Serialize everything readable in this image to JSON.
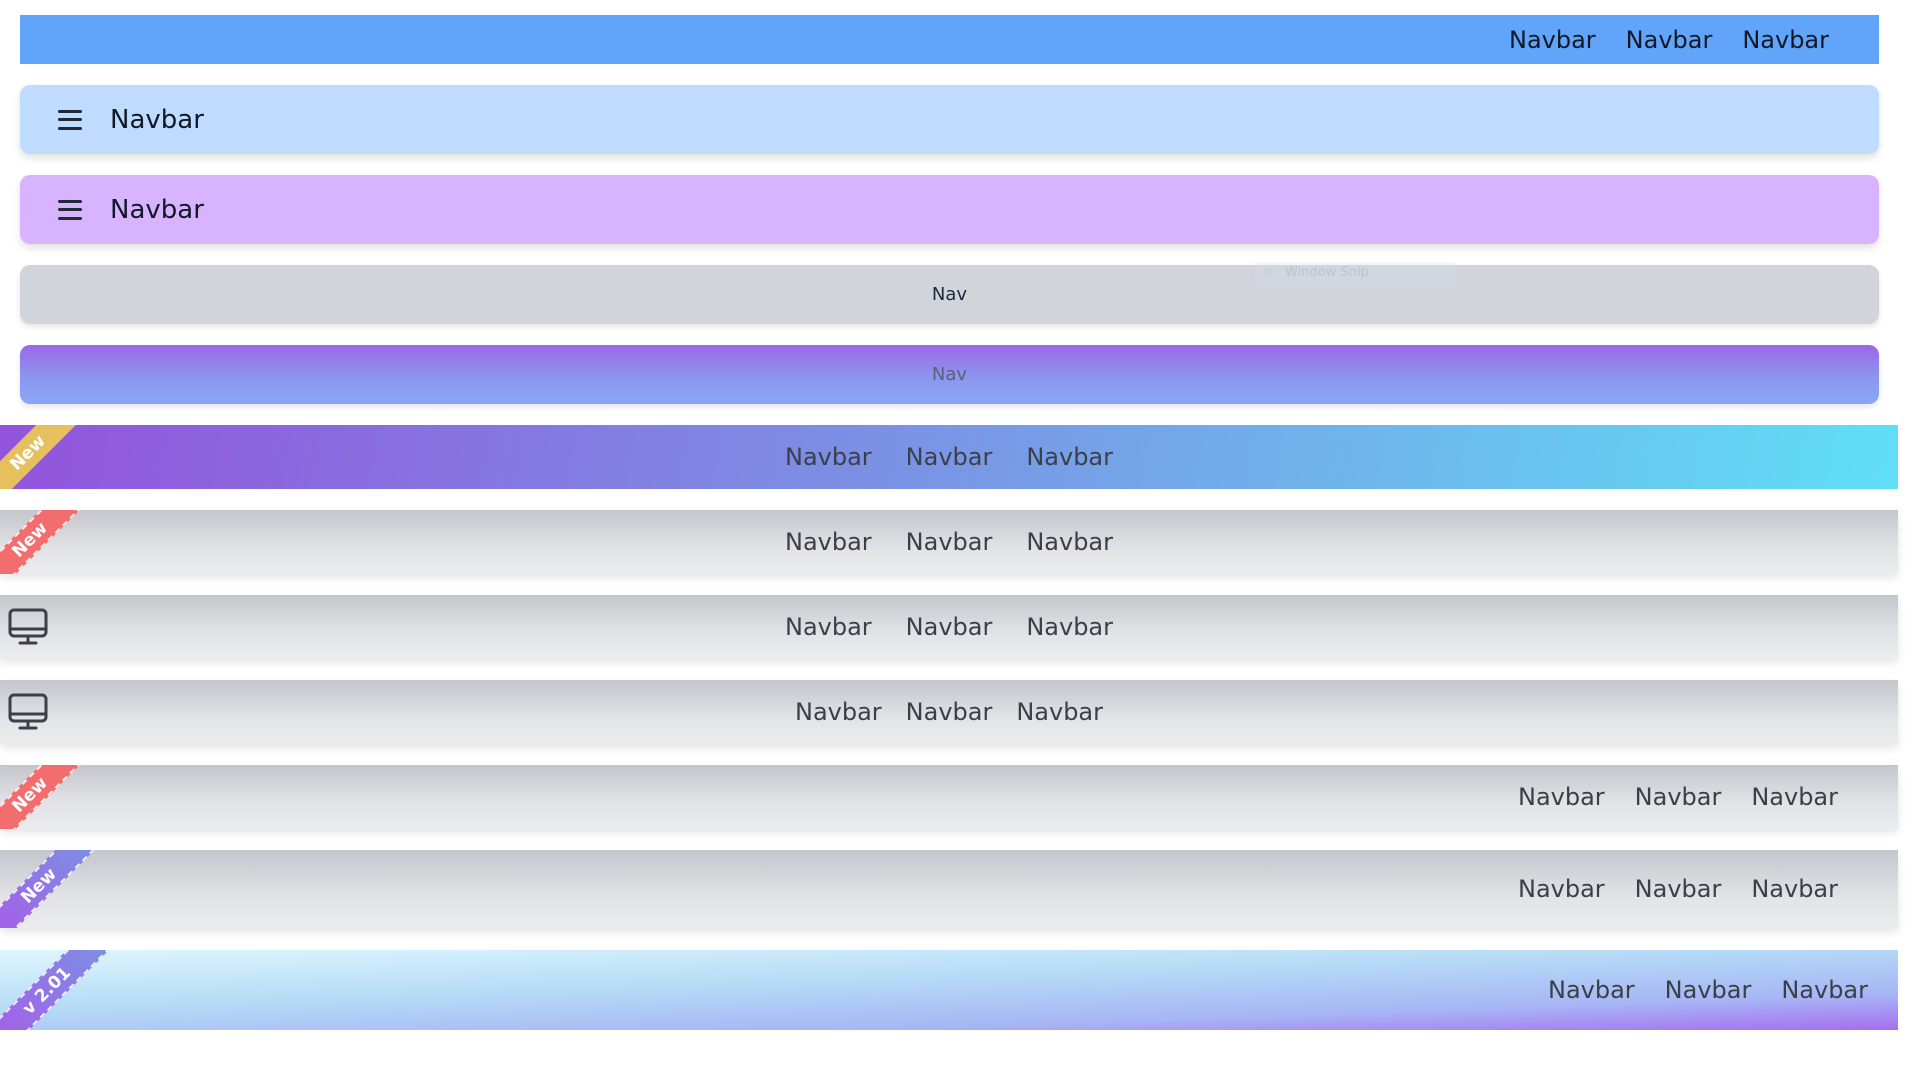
{
  "navbars": {
    "bar1": {
      "links": [
        "Navbar",
        "Navbar",
        "Navbar"
      ],
      "background": "#60a5fa"
    },
    "bar2": {
      "brand": "Navbar",
      "background": "#bfdbfe",
      "icon": "hamburger-menu-icon"
    },
    "bar3": {
      "brand": "Navbar",
      "background": "#d8b4fe",
      "icon": "hamburger-menu-icon"
    },
    "bar4": {
      "text": "Nav",
      "background": "#d1d5db"
    },
    "bar5": {
      "text": "Nav"
    },
    "bar6": {
      "badge": "New",
      "links": [
        "Navbar",
        "Navbar",
        "Navbar"
      ]
    },
    "bar7": {
      "badge": "New",
      "links": [
        "Navbar",
        "Navbar",
        "Navbar"
      ]
    },
    "bar8": {
      "icon": "monitor-icon",
      "links": [
        "Navbar",
        "Navbar",
        "Navbar"
      ]
    },
    "bar9": {
      "icon": "monitor-icon",
      "links": [
        "Navbar",
        "Navbar",
        "Navbar"
      ]
    },
    "bar10": {
      "badge": "New",
      "links": [
        "Navbar",
        "Navbar",
        "Navbar"
      ]
    },
    "bar11": {
      "badge": "New",
      "links": [
        "Navbar",
        "Navbar",
        "Navbar"
      ]
    },
    "bar12": {
      "badge": "v 2.01",
      "links": [
        "Navbar",
        "Navbar",
        "Navbar"
      ]
    }
  },
  "overlay": {
    "label": "Window Snip"
  },
  "colors": {
    "ribbon_gold": "#e6c05c",
    "ribbon_red": "#f26d6d",
    "text_dark": "#3b3f48"
  }
}
